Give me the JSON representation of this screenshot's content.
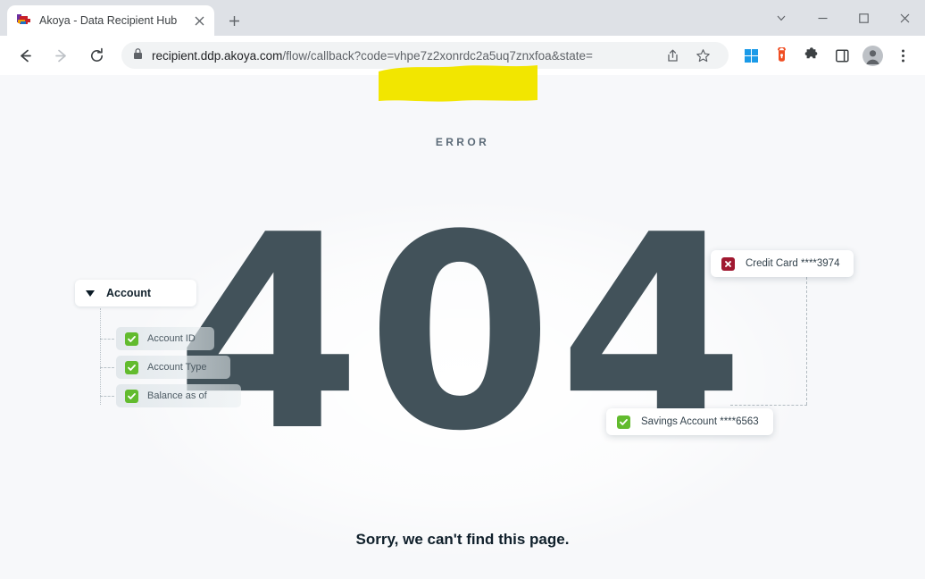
{
  "window": {
    "controls": [
      {
        "name": "tab-search",
        "glyph": "chevron-down"
      },
      {
        "name": "minimize",
        "glyph": "minus"
      },
      {
        "name": "maximize",
        "glyph": "square"
      },
      {
        "name": "close",
        "glyph": "x"
      }
    ]
  },
  "tab": {
    "title": "Akoya - Data Recipient Hub",
    "favicon_name": "akoya-logo-icon",
    "close_label": "×",
    "newtab_label": "+"
  },
  "toolbar": {
    "back_name": "back-button",
    "forward_name": "forward-button",
    "reload_name": "reload-button",
    "lock_name": "site-security-lock-icon",
    "url": {
      "prefix": "recipient.ddp.akoya.com",
      "path": "/flow/callback?code=",
      "code": "vhpe7z2xonrdc2a5uq7znxfoa",
      "suffix": "&state=",
      "full": "recipient.ddp.akoya.com/flow/callback?code=vhpe7z2xonrdc2a5uq7znxfoa&state="
    },
    "icons": [
      {
        "name": "share-icon"
      },
      {
        "name": "bookmark-star-icon"
      },
      {
        "name": "windows-icon"
      },
      {
        "name": "password-manager-icon"
      },
      {
        "name": "extensions-puzzle-icon"
      },
      {
        "name": "side-panel-icon"
      },
      {
        "name": "profile-avatar-icon"
      },
      {
        "name": "chrome-menu-icon"
      }
    ],
    "highlight_color": "#f2e600"
  },
  "page": {
    "error_label": "ERROR",
    "code": "404",
    "message": "Sorry, we can't find this page.",
    "background": "#f7f8fa",
    "digit_color": "#42525a"
  },
  "tree": {
    "header": "Account",
    "items": [
      {
        "label": "Account ID",
        "checked": true
      },
      {
        "label": "Account Type",
        "checked": true
      },
      {
        "label": "Balance as of",
        "checked": true
      }
    ]
  },
  "cards": [
    {
      "label": "Credit Card ****3974",
      "state": "error",
      "icon": "x-checkbox-icon",
      "color": "#a01830"
    },
    {
      "label": "Savings Account ****6563",
      "state": "checked",
      "icon": "check-checkbox-icon",
      "color": "#62bb2e"
    }
  ]
}
